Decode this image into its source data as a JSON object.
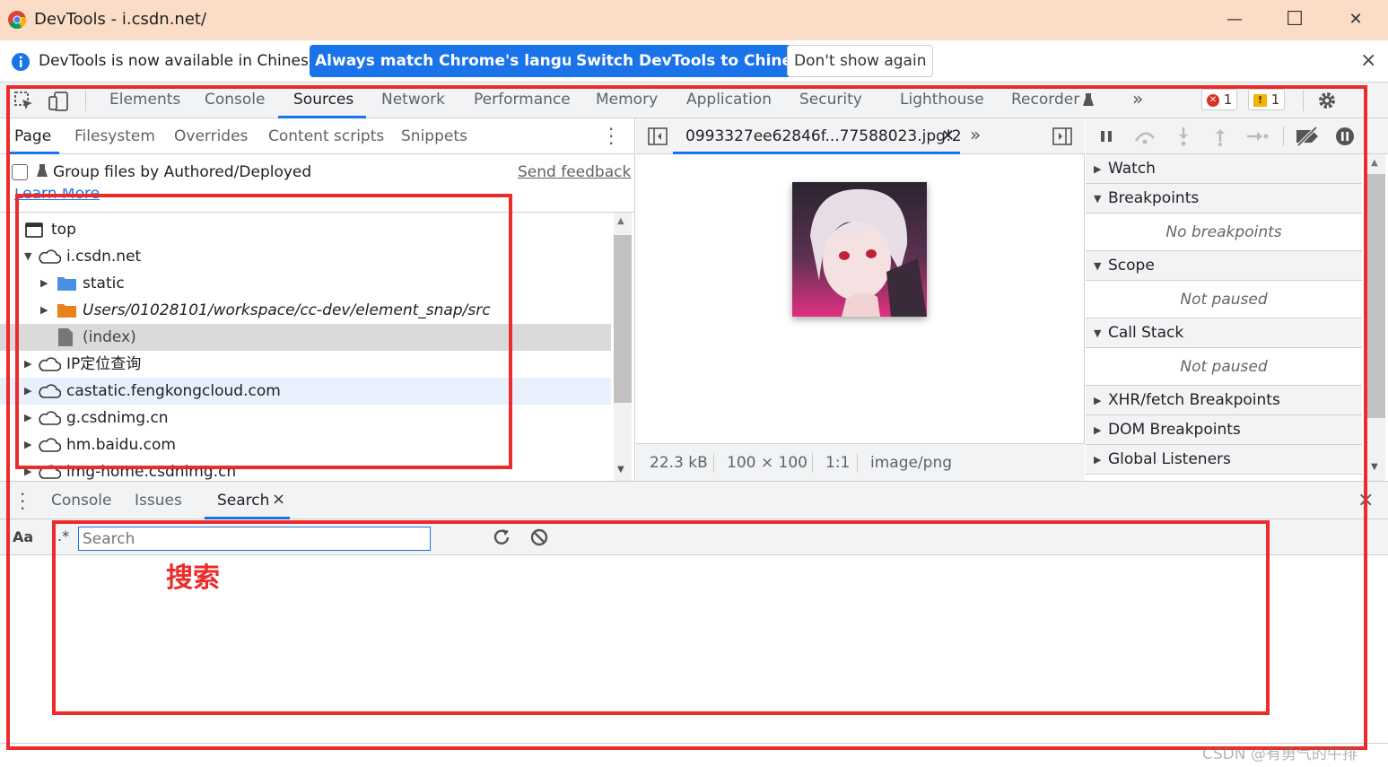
{
  "window": {
    "title": "DevTools - i.csdn.net/",
    "minimize": "—",
    "maximize": "☐",
    "close": "✕"
  },
  "infobar": {
    "message": "DevTools is now available in Chinese!",
    "btn_match": "Always match Chrome's language",
    "btn_switch": "Switch DevTools to Chinese",
    "btn_dismiss": "Don't show again",
    "close": "×"
  },
  "main_tabs": [
    {
      "label": "Elements"
    },
    {
      "label": "Console"
    },
    {
      "label": "Sources"
    },
    {
      "label": "Network"
    },
    {
      "label": "Performance"
    },
    {
      "label": "Memory"
    },
    {
      "label": "Application"
    },
    {
      "label": "Security"
    },
    {
      "label": "Lighthouse"
    },
    {
      "label": "Recorder"
    }
  ],
  "badges": {
    "errors": "1",
    "warnings": "1"
  },
  "left_tabs": [
    {
      "label": "Page"
    },
    {
      "label": "Filesystem"
    },
    {
      "label": "Overrides"
    },
    {
      "label": "Content scripts"
    },
    {
      "label": "Snippets"
    }
  ],
  "group_files": {
    "label": "Group files by Authored/Deployed",
    "send_feedback": "Send feedback",
    "learn_more": "Learn More"
  },
  "tree": [
    {
      "label": "top"
    },
    {
      "label": "i.csdn.net"
    },
    {
      "label": "static"
    },
    {
      "label": "Users/01028101/workspace/cc-dev/element_snap/src"
    },
    {
      "label": "(index)"
    },
    {
      "label": "IP定位查询"
    },
    {
      "label": "castatic.fengkongcloud.com"
    },
    {
      "label": "g.csdnimg.cn"
    },
    {
      "label": "hm.baidu.com"
    },
    {
      "label": "img-home.csdnimg.cn"
    }
  ],
  "editor": {
    "file_tab": "0993327ee62846f...77588023.jpg!2",
    "more": "»",
    "status": {
      "size": "22.3 kB",
      "dimensions": "100 × 100",
      "ratio": "1:1",
      "mime": "image/png"
    }
  },
  "debugger": {
    "sections": [
      {
        "label": "Watch",
        "expanded": false
      },
      {
        "label": "Breakpoints",
        "expanded": true,
        "empty": "No breakpoints"
      },
      {
        "label": "Scope",
        "expanded": true,
        "empty": "Not paused"
      },
      {
        "label": "Call Stack",
        "expanded": true,
        "empty": "Not paused"
      },
      {
        "label": "XHR/fetch Breakpoints",
        "expanded": false
      },
      {
        "label": "DOM Breakpoints",
        "expanded": false
      },
      {
        "label": "Global Listeners",
        "expanded": false
      }
    ]
  },
  "drawer": {
    "tabs": [
      {
        "label": "Console"
      },
      {
        "label": "Issues"
      },
      {
        "label": "Search"
      }
    ],
    "close_tab": "×",
    "case_toggle": "Aa",
    "regex_toggle": ".*",
    "search_placeholder": "Search",
    "annotation": "搜索"
  },
  "watermark": "CSDN @有勇气的牛排",
  "colors": {
    "accent": "#1a73e8",
    "annotation_red": "#ee2b2b",
    "titlebar": "#fbdcc7"
  }
}
